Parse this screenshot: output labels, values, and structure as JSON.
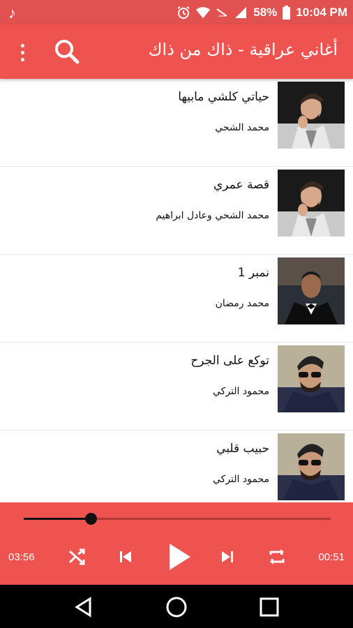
{
  "status_bar": {
    "battery": "58%",
    "time": "10:04 PM"
  },
  "app_bar": {
    "title": "أغاني عراقية - ذاك من ذاك"
  },
  "songs": [
    {
      "title": "حياتي كلشي مابيها",
      "artist": "محمد الشحي",
      "thumb_icon": "singer-photo"
    },
    {
      "title": "قصة عمري",
      "artist": "محمد الشحي وعادل ابراهيم",
      "thumb_icon": "singer-photo"
    },
    {
      "title": "نمبر 1",
      "artist": "محمد رمضان",
      "thumb_icon": "singer-photo"
    },
    {
      "title": "توكع على الجرح",
      "artist": "محمود التركي",
      "thumb_icon": "singer-photo"
    },
    {
      "title": "حبيب قلبي",
      "artist": "محمود التركي",
      "thumb_icon": "singer-photo"
    }
  ],
  "player": {
    "elapsed": "03:56",
    "remaining": "00:51",
    "progress_fraction": 0.22
  },
  "colors": {
    "primary": "#ef5350",
    "status": "#e0514f"
  }
}
